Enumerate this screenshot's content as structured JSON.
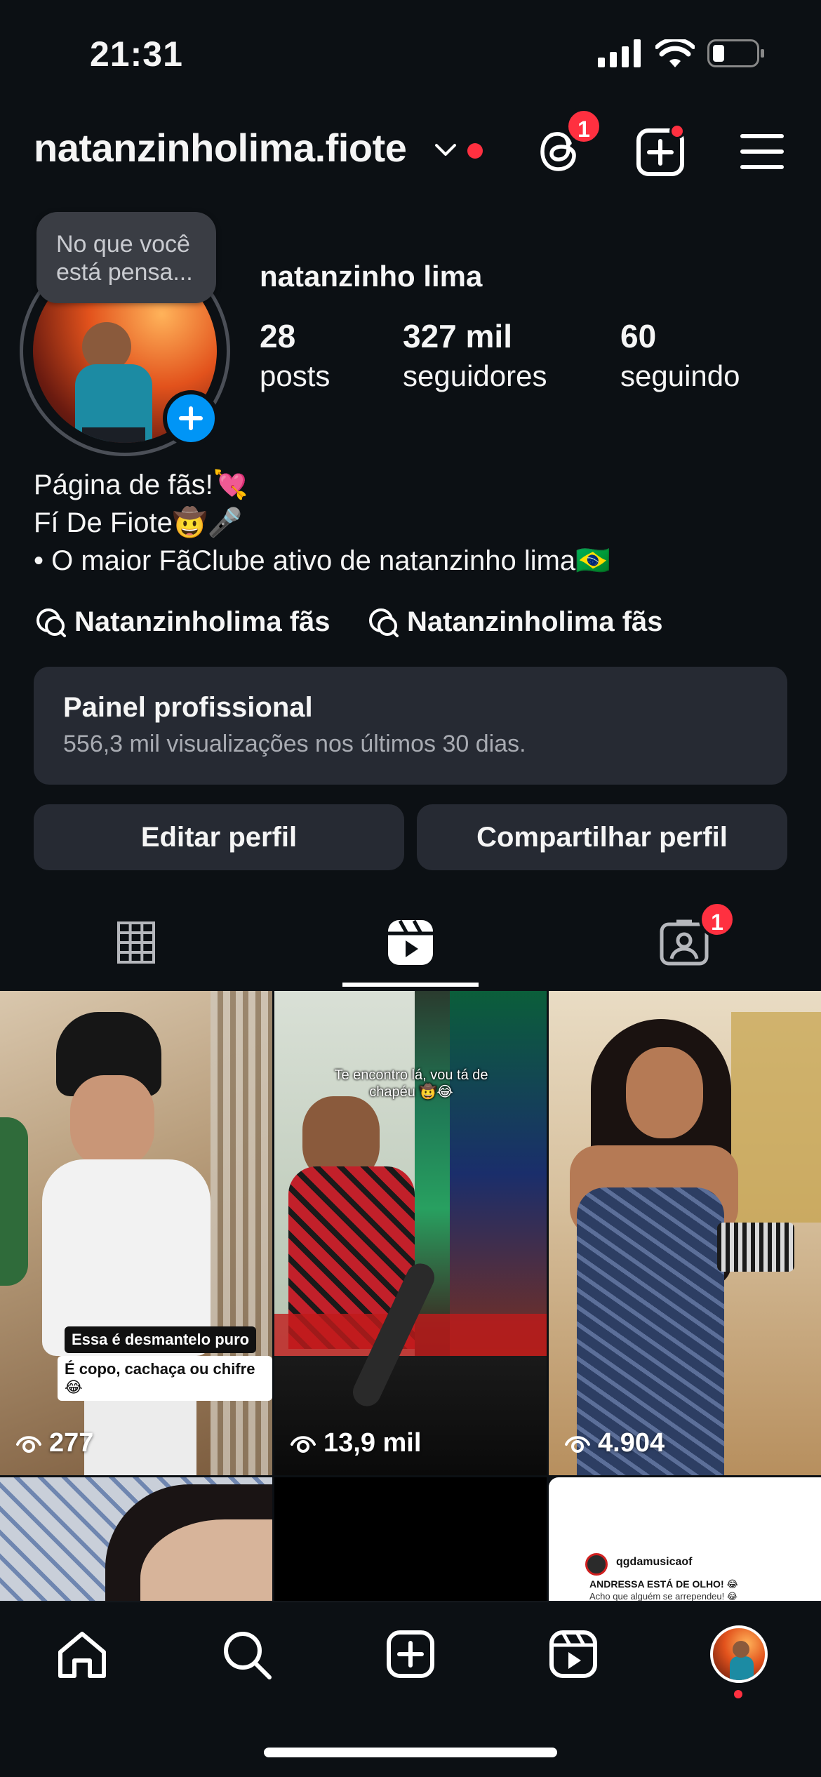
{
  "status_bar": {
    "time": "21:31"
  },
  "header": {
    "username": "natanzinholima.fiote",
    "threads_badge": "1"
  },
  "profile": {
    "note_bubble": "No que você está pensa...",
    "display_name": "natanzinho lima",
    "stats": [
      {
        "value": "28",
        "label": "posts"
      },
      {
        "value": "327 mil",
        "label": "seguidores"
      },
      {
        "value": "60",
        "label": "seguindo"
      }
    ],
    "bio": [
      "Página de fãs!💘",
      "Fí De Fiote🤠🎤",
      "• O maior FãClube ativo de natanzinho lima🇧🇷"
    ],
    "threads_links": [
      "Natanzinholima fãs",
      "Natanzinholima fãs"
    ]
  },
  "dashboard": {
    "title": "Painel profissional",
    "subtitle": "556,3 mil visualizações nos últimos 30 dias."
  },
  "actions": {
    "edit": "Editar perfil",
    "share": "Compartilhar perfil"
  },
  "tabs": {
    "tagged_badge": "1"
  },
  "grid": [
    {
      "views": "277",
      "caption1": "Essa é desmantelo puro",
      "caption2": "É copo, cachaça ou chifre 😂"
    },
    {
      "views": "13,9 mil",
      "caption1": "Te encontro lá, vou tá de chapéu 🤠😂"
    },
    {
      "views": "4.904"
    }
  ],
  "grid_row2": {
    "card_account": "qgdamusicaof",
    "card_line1": "ANDRESSA ESTÁ DE OLHO! 😂",
    "card_line2": "Acho que alguém se arrependeu! 😂"
  },
  "colors": {
    "background": "#0c1014",
    "accent_red": "#ff3040",
    "button": "#262a33",
    "blue": "#0095f6"
  }
}
